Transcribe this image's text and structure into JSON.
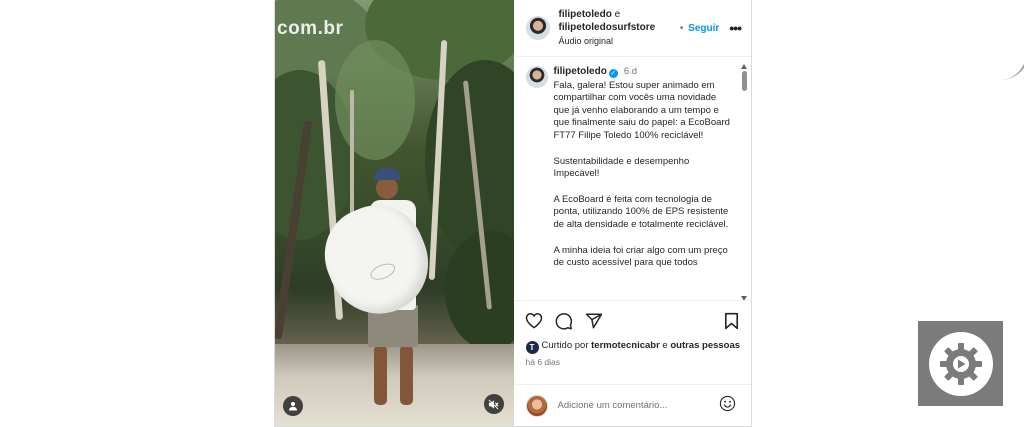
{
  "media": {
    "watermark": "com.br",
    "user_tag_icon": "user-tag-icon",
    "mute_icon": "speaker-muted-icon"
  },
  "header": {
    "author_primary": "filipetoledo",
    "joiner": " e ",
    "author_secondary": "filipetoledosurfstore",
    "audio": "Áudio original",
    "follow_dot": "•",
    "follow_label": "Seguir",
    "more_icon": "more-dots-icon"
  },
  "caption": {
    "username": "filipetoledo",
    "verified_mark": "✓",
    "time": "6 d",
    "paragraphs": [
      "Fala, galera! Estou super animado em compartilhar com vocês uma novidade que já venho elaborando a um tempo e que finalmente saiu do papel: a EcoBoard FT77 Filipe Toledo 100% reciclável!",
      "Sustentabilidade e desempenho Impecável!",
      "A EcoBoard é feita com tecnologia de ponta, utilizando 100% de EPS resistente de alta densidade e totalmente reciclável.",
      "A minha ideia foi criar algo com um preço de custo acessível para que todos"
    ]
  },
  "actions": {
    "like_icon": "heart-icon",
    "comment_icon": "comment-icon",
    "share_icon": "share-icon",
    "save_icon": "bookmark-icon"
  },
  "likes": {
    "avatar_letter": "T",
    "prefix": "Curtido por ",
    "liker": "termotecnicabr",
    "joiner": " e ",
    "others": "outras pessoas"
  },
  "date": "há 6 dias",
  "comment": {
    "placeholder": "Adicione um comentário...",
    "emoji_icon": "emoji-icon"
  },
  "widget": {
    "icon": "gear-icon"
  }
}
